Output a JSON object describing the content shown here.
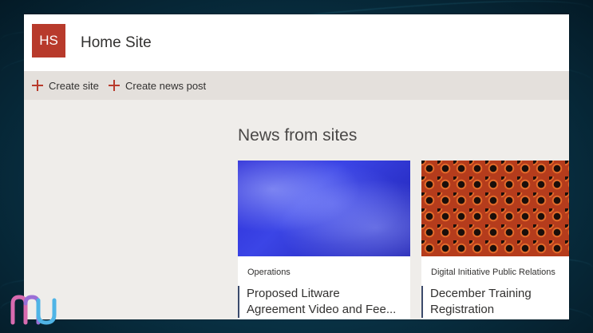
{
  "header": {
    "logo_initials": "HS",
    "site_title": "Home Site",
    "logo_color": "#b83a2b"
  },
  "commandbar": {
    "create_site_label": "Create site",
    "create_news_post_label": "Create news post",
    "icon": "plus-icon"
  },
  "main": {
    "news_heading": "News from sites",
    "cards": [
      {
        "category": "Operations",
        "title": "Proposed Litware Agreement Video and Fee...",
        "image": "blue-abstract-image"
      },
      {
        "category": "Digital Initiative Public Relations",
        "title": "December Training Registration",
        "image": "orange-hexagon-pattern-image"
      }
    ]
  },
  "colors": {
    "accent": "#b83a2b",
    "command_bar_bg": "#e4e0dc",
    "page_bg": "#efedea",
    "card_title_rule": "#3b4a6b"
  },
  "overlay": {
    "brand_logo": "mu-logo-icon",
    "cursor": "pointer-cursor-icon"
  }
}
